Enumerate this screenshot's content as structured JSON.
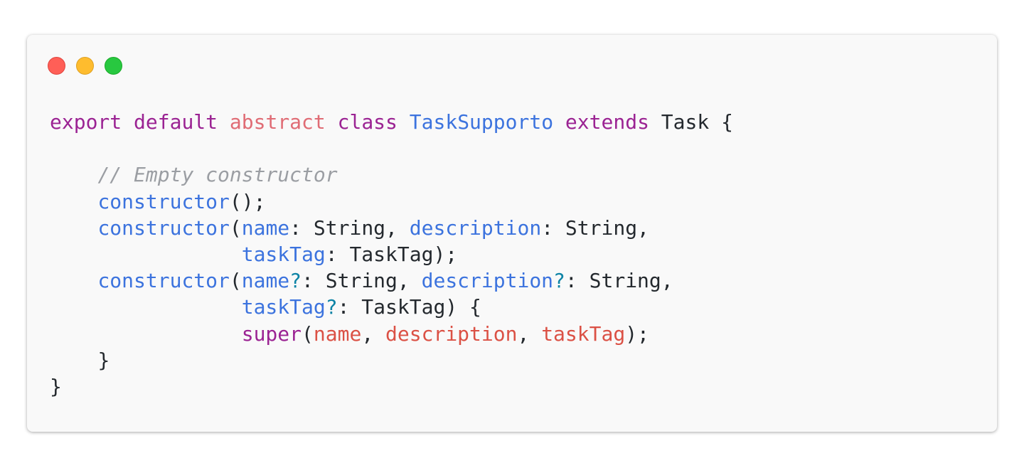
{
  "window_controls": [
    "close",
    "minimize",
    "zoom"
  ],
  "code": {
    "line1": {
      "export": "export",
      "default": "default",
      "abstract": "abstract",
      "class": "class",
      "classname": "TaskSupporto",
      "extends": "extends",
      "base": "Task",
      "brace": "{"
    },
    "line3": {
      "comment": "// Empty constructor"
    },
    "line4": {
      "ctor": "constructor",
      "rest": "();"
    },
    "line5": {
      "ctor": "constructor",
      "p1": "name",
      "t1": ": String, ",
      "p2": "description",
      "t2": ": String,"
    },
    "line6": {
      "p3": "taskTag",
      "t3": ": TaskTag);"
    },
    "line7": {
      "ctor": "constructor",
      "p1": "name",
      "q1": "?",
      "t1": ": String, ",
      "p2": "description",
      "q2": "?",
      "t2": ": String,"
    },
    "line8": {
      "p3": "taskTag",
      "q3": "?",
      "t3": ": TaskTag) {"
    },
    "line9": {
      "super": "super",
      "a1": "name",
      "a2": "description",
      "a3": "taskTag",
      "end": ");"
    },
    "line10": {
      "brace": "}"
    },
    "line11": {
      "brace": "}"
    }
  },
  "colors": {
    "keyword": "#9b2393",
    "abstract": "#e06c75",
    "identifier": "#3c73de",
    "optional": "#0e84a6",
    "argument": "#db5145",
    "comment": "#9b9ea3",
    "text": "#24292e"
  }
}
